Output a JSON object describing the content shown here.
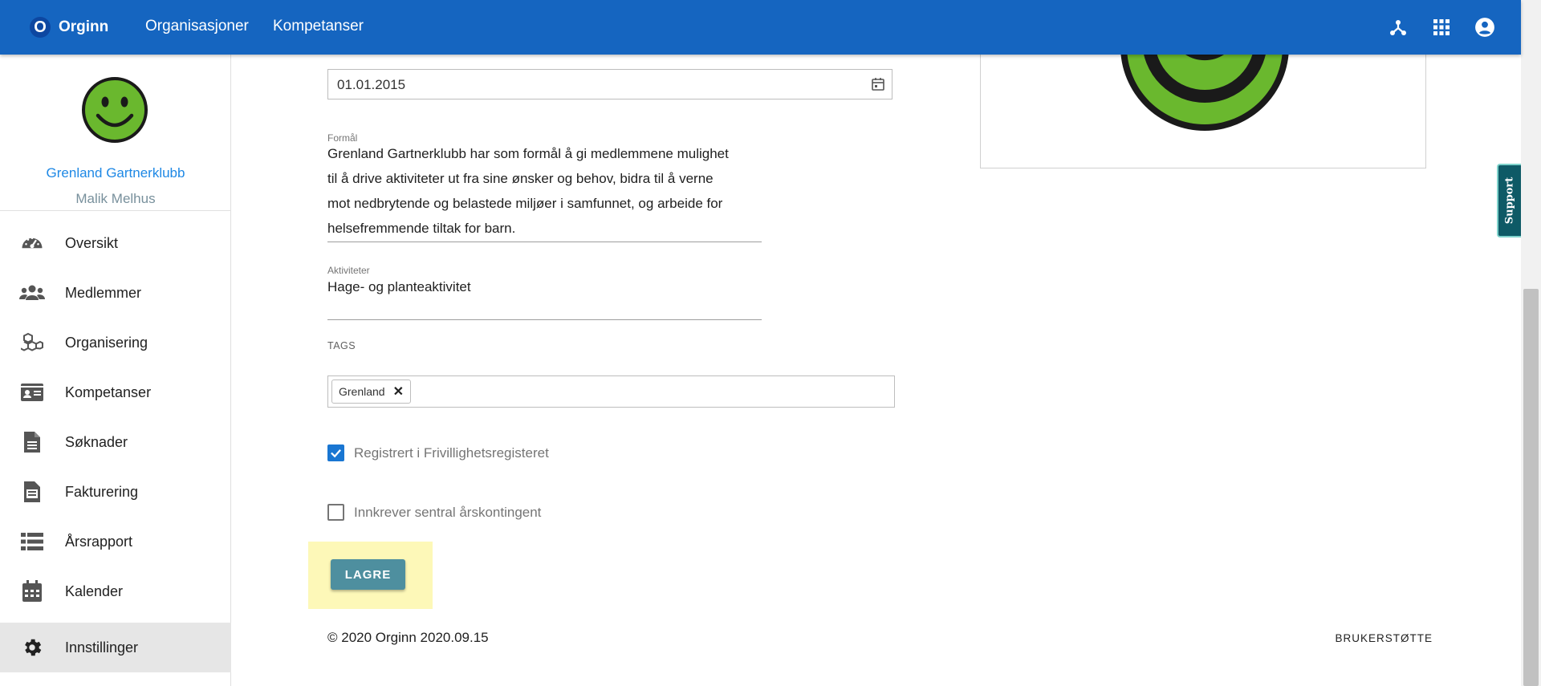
{
  "topbar": {
    "logo_letter": "O",
    "brand": "Orginn",
    "nav": [
      "Organisasjoner",
      "Kompetanser"
    ],
    "icons": [
      "hub-icon",
      "apps-grid-icon",
      "account-circle-icon"
    ]
  },
  "sidebar": {
    "org_name": "Grenland Gartnerklubb",
    "user_name": "Malik Melhus",
    "items": [
      {
        "label": "Oversikt",
        "icon": "speedometer-icon"
      },
      {
        "label": "Medlemmer",
        "icon": "people-icon"
      },
      {
        "label": "Organisering",
        "icon": "cubes-icon"
      },
      {
        "label": "Kompetanser",
        "icon": "id-card-icon"
      },
      {
        "label": "Søknader",
        "icon": "document-icon"
      },
      {
        "label": "Fakturering",
        "icon": "invoice-icon"
      },
      {
        "label": "Årsrapport",
        "icon": "list-icon"
      },
      {
        "label": "Kalender",
        "icon": "calendar-icon"
      },
      {
        "label": "Innstillinger",
        "icon": "gear-icon",
        "active": true
      }
    ]
  },
  "form": {
    "date_value": "01.01.2015",
    "purpose_label": "Formål",
    "purpose_lines": [
      "Grenland Gartnerklubb har som formål å gi medlemmene mulighet",
      "til å drive aktiviteter ut fra sine ønsker og behov, bidra til å verne",
      "mot nedbrytende og belastede miljøer i samfunnet, og arbeide for",
      "helsefremmende tiltak for barn."
    ],
    "activities_label": "Aktiviteter",
    "activities_value": "Hage- og planteaktivitet",
    "tags_title": "TAGS",
    "tags": [
      "Grenland"
    ],
    "checkbox_registered": {
      "label": "Registrert i Frivillighetsregisteret",
      "checked": true
    },
    "checkbox_fee": {
      "label": "Innkrever sentral årskontingent",
      "checked": false
    },
    "save_label": "LAGRE"
  },
  "footer": {
    "copyright": "© 2020 Orginn 2020.09.15",
    "support_link": "BRUKERSTØTTE"
  },
  "support_tab": "Support",
  "colors": {
    "topbar": "#1565c0",
    "link": "#1e88e5",
    "save_button": "#4e8f9f",
    "highlight": "#fdf8b8",
    "support_tab": "#0e5a66",
    "smiley_green": "#6ab82e"
  }
}
